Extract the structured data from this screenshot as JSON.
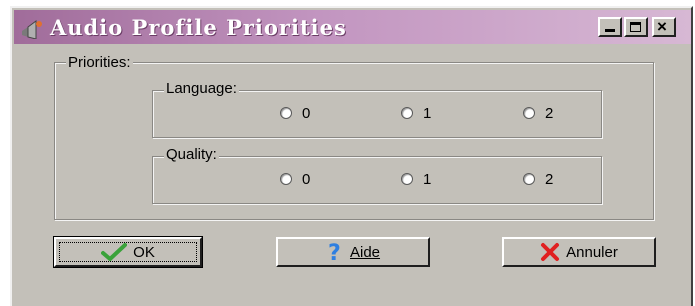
{
  "window": {
    "title": "Audio Profile Priorities",
    "title_icon": "speaker-icon",
    "controls": [
      "minimize-icon",
      "maximize-icon",
      "close-icon"
    ],
    "close_glyph": "×"
  },
  "priorities": {
    "label": "Priorities:",
    "language": {
      "label": "Language:",
      "options": [
        "0",
        "1",
        "2"
      ],
      "selected": null
    },
    "quality": {
      "label": "Quality:",
      "options": [
        "0",
        "1",
        "2"
      ],
      "selected": null
    }
  },
  "buttons": {
    "ok": {
      "label": "OK",
      "icon": "checkmark-icon"
    },
    "help": {
      "label": "Aide",
      "icon": "question-mark-icon"
    },
    "cancel": {
      "label": "Annuler",
      "icon": "red-x-icon"
    }
  },
  "colors": {
    "titlebar_start": "#a06c9a",
    "titlebar_end": "#d7b8d4",
    "face": "#c3c0b9",
    "help_icon": "#2f7fe0",
    "cancel_icon": "#e02020",
    "ok_icon": "#3aa23a"
  }
}
